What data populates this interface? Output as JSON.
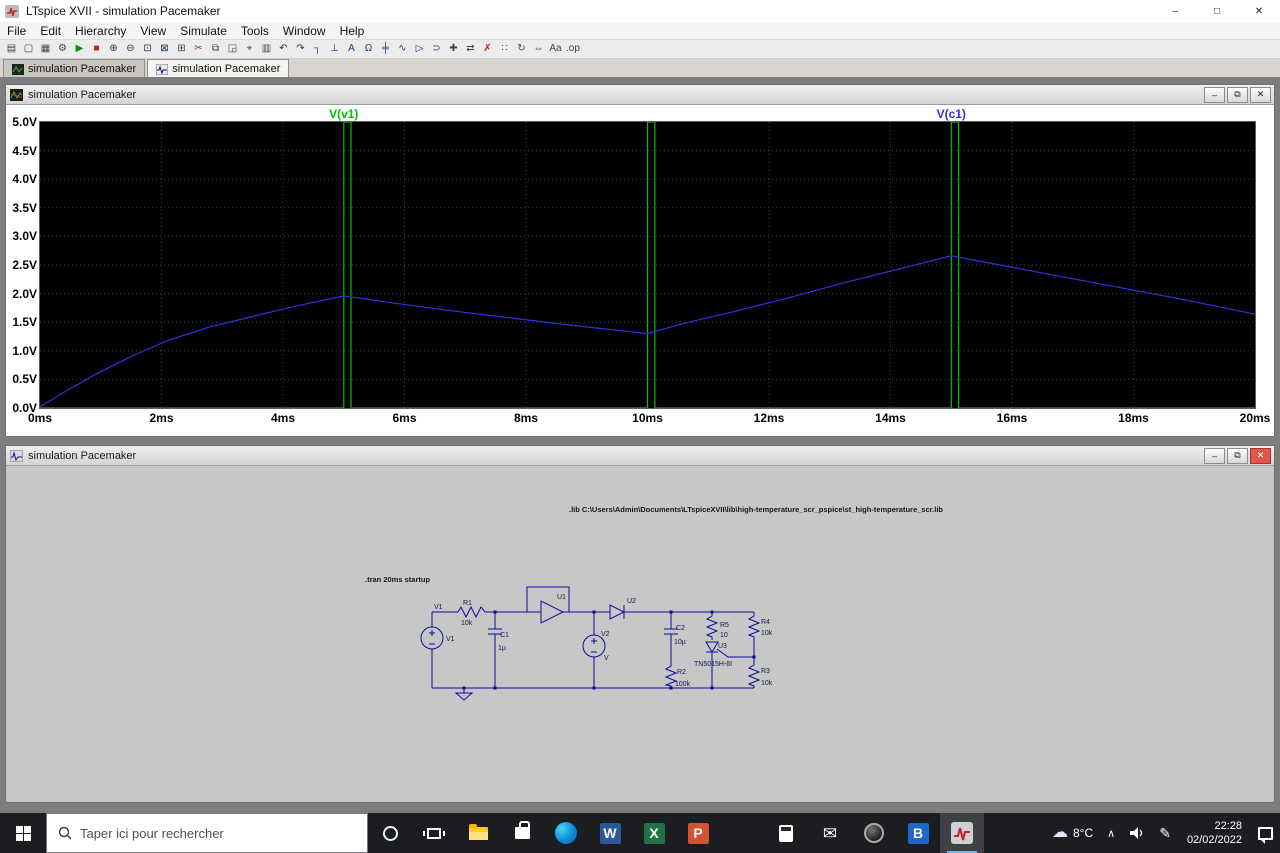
{
  "window": {
    "title": "LTspice XVII - simulation Pacemaker"
  },
  "window_controls": {
    "minimize": "–",
    "maximize": "□",
    "close": "✕"
  },
  "menu": {
    "items": [
      "File",
      "Edit",
      "Hierarchy",
      "View",
      "Simulate",
      "Tools",
      "Window",
      "Help"
    ]
  },
  "toolbar": {
    "items": [
      {
        "name": "new-schematic",
        "glyph": "▤"
      },
      {
        "name": "open",
        "glyph": "▢"
      },
      {
        "name": "save",
        "glyph": "▦"
      },
      {
        "name": "control-panel",
        "glyph": "⚙"
      },
      {
        "name": "run",
        "glyph": "▶",
        "color": "#0d8a0d"
      },
      {
        "name": "halt",
        "glyph": "■",
        "color": "#bb2222"
      },
      {
        "name": "zoom-in",
        "glyph": "⊕",
        "color": "#223355"
      },
      {
        "name": "zoom-out",
        "glyph": "⊖",
        "color": "#223355"
      },
      {
        "name": "zoom-area",
        "glyph": "⊡",
        "color": "#223355"
      },
      {
        "name": "zoom-fit",
        "glyph": "⊠",
        "color": "#223355"
      },
      {
        "name": "grid",
        "glyph": "⊞"
      },
      {
        "name": "cut",
        "glyph": "✂",
        "color": "#993333"
      },
      {
        "name": "copy",
        "glyph": "⧉"
      },
      {
        "name": "paste",
        "glyph": "◲"
      },
      {
        "name": "find",
        "glyph": "⌖"
      },
      {
        "name": "print",
        "glyph": "▥"
      },
      {
        "name": "undo",
        "glyph": "↶",
        "color": "#113366"
      },
      {
        "name": "redo",
        "glyph": "↷",
        "color": "#113366"
      },
      {
        "name": "wire",
        "glyph": "┐",
        "color": "#223a8f"
      },
      {
        "name": "ground",
        "glyph": "⊥",
        "color": "#223a8f"
      },
      {
        "name": "label-net",
        "glyph": "A",
        "color": "#223a8f"
      },
      {
        "name": "resistor",
        "glyph": "Ω",
        "color": "#223a8f"
      },
      {
        "name": "capacitor",
        "glyph": "╪",
        "color": "#223a8f"
      },
      {
        "name": "inductor",
        "glyph": "∿",
        "color": "#223a8f"
      },
      {
        "name": "diode",
        "glyph": "▷",
        "color": "#223a8f"
      },
      {
        "name": "component",
        "glyph": "⊃",
        "color": "#223a8f"
      },
      {
        "name": "move",
        "glyph": "✚"
      },
      {
        "name": "drag",
        "glyph": "⇄"
      },
      {
        "name": "delete",
        "glyph": "✗",
        "color": "#aa2222"
      },
      {
        "name": "duplicate",
        "glyph": "∷"
      },
      {
        "name": "rotate",
        "glyph": "↻"
      },
      {
        "name": "mirror",
        "glyph": "⇔"
      },
      {
        "name": "text",
        "glyph": "Aa"
      },
      {
        "name": "spice-directive",
        "glyph": ".op"
      }
    ]
  },
  "tabs": [
    {
      "label": "simulation Pacemaker"
    },
    {
      "label": "simulation Pacemaker"
    }
  ],
  "wave_window": {
    "title": "simulation Pacemaker",
    "controls": {
      "minimize": "–",
      "restore": "⧉",
      "close": "✕"
    }
  },
  "schematic_window": {
    "title": "simulation Pacemaker",
    "controls": {
      "minimize": "–",
      "restore": "⧉",
      "close": "✕"
    }
  },
  "chart_data": {
    "type": "line",
    "title": "",
    "xlim": [
      0,
      20
    ],
    "ylim": [
      0,
      5
    ],
    "x_ticks": [
      "0ms",
      "2ms",
      "4ms",
      "6ms",
      "8ms",
      "10ms",
      "12ms",
      "14ms",
      "16ms",
      "18ms",
      "20ms"
    ],
    "y_ticks": [
      "5.0V",
      "4.5V",
      "4.0V",
      "3.5V",
      "3.0V",
      "2.5V",
      "2.0V",
      "1.5V",
      "1.0V",
      "0.5V",
      "0.0V"
    ],
    "grid": true,
    "background": "#000000",
    "legend_position": "top",
    "series": [
      {
        "name": "V(v1)",
        "color": "#00c000",
        "x": [
          0,
          5,
          5,
          5.12,
          5.12,
          10,
          10,
          10.12,
          10.12,
          15,
          15,
          15.12,
          15.12,
          20
        ],
        "y": [
          0,
          0,
          5,
          5,
          0,
          0,
          5,
          5,
          0,
          0,
          5,
          5,
          0,
          0
        ]
      },
      {
        "name": "V(c1)",
        "color": "#3232dc",
        "x": [
          0,
          0.4,
          0.9,
          1.5,
          2.1,
          2.8,
          3.5,
          4.2,
          5,
          5.8,
          6.7,
          7.7,
          8.8,
          10,
          10.6,
          11.4,
          12.3,
          13.2,
          14.1,
          15,
          15.8,
          16.7,
          17.7,
          18.8,
          20
        ],
        "y": [
          0.02,
          0.28,
          0.58,
          0.9,
          1.18,
          1.42,
          1.6,
          1.78,
          1.96,
          1.84,
          1.71,
          1.58,
          1.44,
          1.3,
          1.48,
          1.68,
          1.92,
          2.18,
          2.42,
          2.66,
          2.5,
          2.32,
          2.12,
          1.9,
          1.64
        ]
      }
    ]
  },
  "schematic": {
    "lib_directive": ".lib C:\\Users\\Admin\\Documents\\LTspiceXVII\\lib\\high-temperature_scr_pspice\\st_high-temperature_scr.lib",
    "tran_directive": ".tran 20ms startup",
    "components": {
      "v1_net": "V1",
      "v1": {
        "name": "V1"
      },
      "r1": {
        "name": "R1",
        "value": "10k"
      },
      "c1": {
        "name": "C1",
        "value": "1µ"
      },
      "u1": {
        "name": "U1"
      },
      "u2": {
        "name": "U2"
      },
      "v2": {
        "name": "V2",
        "value": "V"
      },
      "c2": {
        "name": "C2",
        "value": "10µ"
      },
      "r5": {
        "name": "R5",
        "value": "10"
      },
      "u3": {
        "name": "U3",
        "value": "TN5015H-6I"
      },
      "r4": {
        "name": "R4",
        "value": "10k"
      },
      "r2": {
        "name": "R2",
        "value": "100k"
      },
      "r3": {
        "name": "R3",
        "value": "10k"
      }
    }
  },
  "taskbar": {
    "search_placeholder": "Taper ici pour rechercher",
    "apps": [
      {
        "name": "cortana"
      },
      {
        "name": "task-view"
      },
      {
        "name": "file-explorer"
      },
      {
        "name": "microsoft-store"
      },
      {
        "name": "edge"
      },
      {
        "name": "word",
        "letter": "W",
        "color": "#2b579a"
      },
      {
        "name": "excel",
        "letter": "X",
        "color": "#217346"
      },
      {
        "name": "powerpoint",
        "letter": "P",
        "color": "#d35230"
      },
      {
        "name": "settings"
      },
      {
        "name": "calculator"
      },
      {
        "name": "mail"
      },
      {
        "name": "browser"
      },
      {
        "name": "b-app",
        "letter": "B",
        "color": "#1e66c9"
      },
      {
        "name": "ltspice",
        "active": true
      }
    ],
    "tray": {
      "temperature": "8°C",
      "time": "22:28",
      "date": "02/02/2022"
    }
  }
}
